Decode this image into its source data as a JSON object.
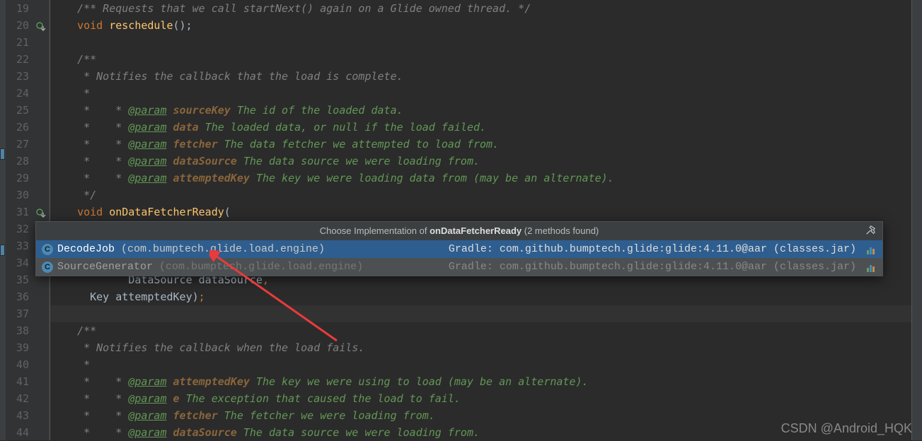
{
  "gutter": {
    "start": 19,
    "end": 44
  },
  "code": {
    "l19": {
      "pre": "  ",
      "cmt": "/** Requests that we call startNext() again on a Glide owned thread. */"
    },
    "l20": {
      "pre": "  ",
      "kw": "void ",
      "fn": "reschedule",
      "tail": "();"
    },
    "l22": {
      "pre": "  ",
      "cmt": "/**"
    },
    "l23": {
      "pre": "   ",
      "cmt": "* Notifies the callback that the load is complete."
    },
    "l24": {
      "pre": "   ",
      "cmt": "*"
    },
    "l25": {
      "pre": "   * ",
      "kw": "@param",
      "pn": " sourceKey",
      "rest": " The id of the loaded data."
    },
    "l26": {
      "pre": "   * ",
      "kw": "@param",
      "pn": " data",
      "rest": " The loaded data, or null if the load failed."
    },
    "l27": {
      "pre": "   * ",
      "kw": "@param",
      "pn": " fetcher",
      "rest": " The data fetcher we attempted to load from."
    },
    "l28": {
      "pre": "   * ",
      "kw": "@param",
      "pn": " dataSource",
      "rest": " The data source we were loading from."
    },
    "l29": {
      "pre": "   * ",
      "kw": "@param",
      "pn": " attemptedKey",
      "rest": " The key we were loading data from (may be an alternate)."
    },
    "l30": {
      "pre": "   ",
      "cmt": "*/"
    },
    "l31": {
      "pre": "  ",
      "kw": "void ",
      "fn": "onDataFetcherReady",
      "tail": "("
    },
    "l34": {
      "pre": "      ",
      "pln": "DataSource dataSource",
      "tail": ","
    },
    "l35": {
      "pre": "      ",
      "pln": "Key attemptedKey)",
      "tail": ";"
    },
    "l38": {
      "pre": "  ",
      "cmt": "/**"
    },
    "l39": {
      "pre": "   ",
      "cmt": "* Notifies the callback when the load fails."
    },
    "l40": {
      "pre": "   ",
      "cmt": "*"
    },
    "l41": {
      "pre": "   * ",
      "kw": "@param",
      "pn": " attemptedKey",
      "rest": " The key we were using to load (may be an alternate)."
    },
    "l42": {
      "pre": "   * ",
      "kw": "@param",
      "pn": " e",
      "rest": " The exception that caused the load to fail."
    },
    "l43": {
      "pre": "   * ",
      "kw": "@param",
      "pn": " fetcher",
      "rest": " The fetcher we were loading from."
    },
    "l44": {
      "pre": "   * ",
      "kw": "@param",
      "pn": " dataSource",
      "rest": " The data source we were loading from."
    }
  },
  "popup": {
    "title_pre": "Choose Implementation of ",
    "title_bold": "onDataFetcherReady",
    "title_post": " (2 methods found)",
    "rows": [
      {
        "name": "DecodeJob ",
        "pkg": "(com.bumptech.glide.load.engine)",
        "right": "Gradle: com.github.bumptech.glide:glide:4.11.0@aar (classes.jar) "
      },
      {
        "name": "SourceGenerator ",
        "pkg": "(com.bumptech.glide.load.engine)",
        "right": "Gradle: com.github.bumptech.glide:glide:4.11.0@aar (classes.jar) "
      }
    ]
  },
  "watermark": "CSDN @Android_HQK"
}
